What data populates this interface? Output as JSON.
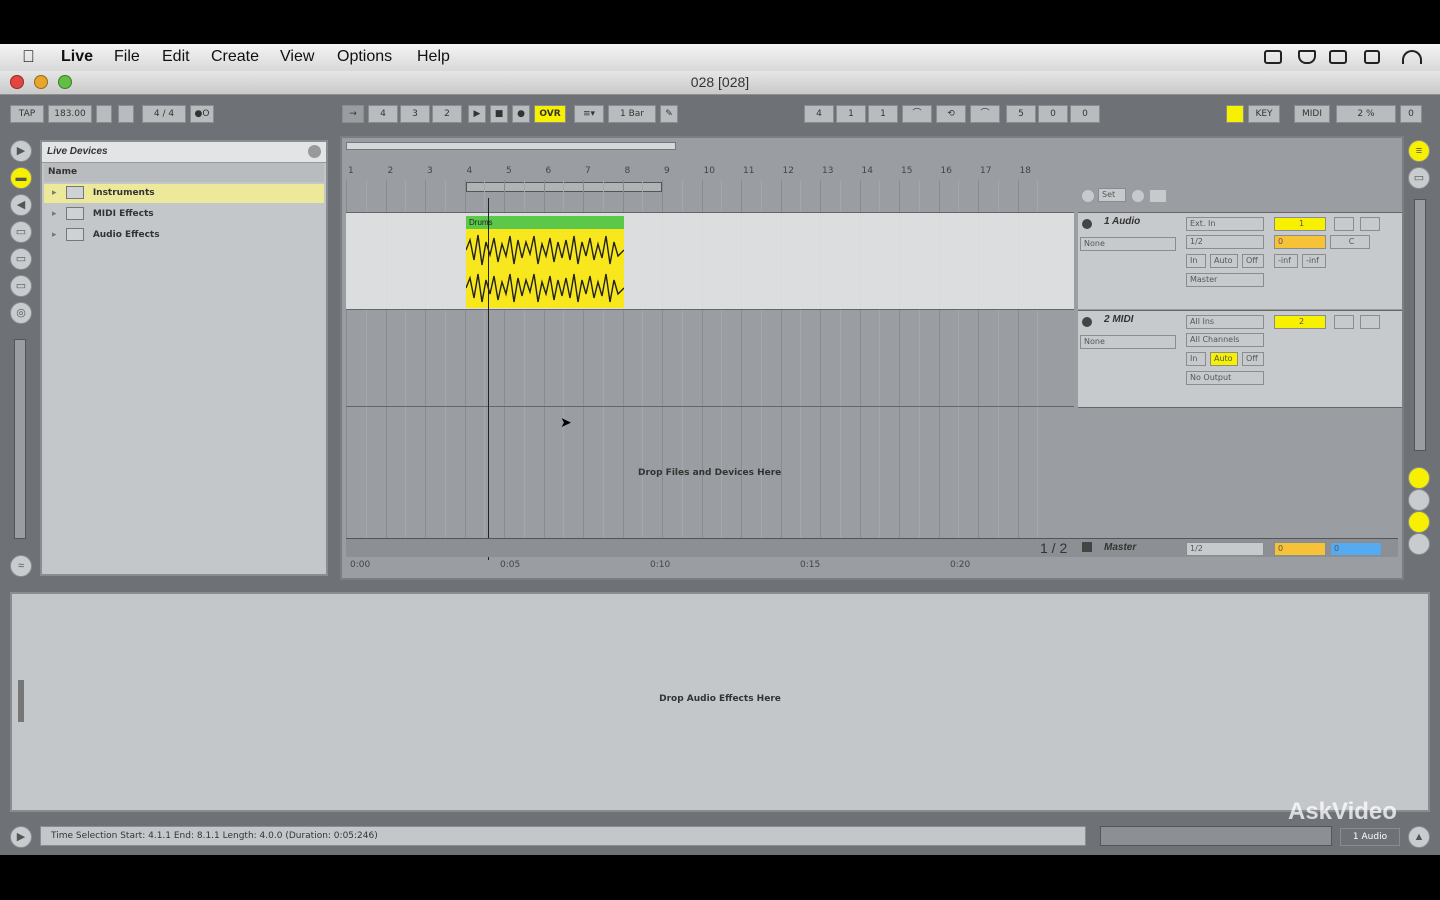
{
  "menubar": {
    "apple": "",
    "items": [
      "Live",
      "File",
      "Edit",
      "Create",
      "View",
      "Options",
      "Help"
    ]
  },
  "window": {
    "title": "028 [028]"
  },
  "transport": {
    "tap": "TAP",
    "tempo": "183.00",
    "signature": "4 / 4",
    "metro": "●O",
    "position": [
      "4",
      "3",
      "2"
    ],
    "ovr": "OVR",
    "quantize": "1 Bar",
    "loop_start": [
      "4",
      "1",
      "1"
    ],
    "loop_length": [
      "5",
      "0",
      "0"
    ],
    "key": "KEY",
    "midi": "MIDI",
    "cpu": "2 %",
    "disk": "0"
  },
  "browser": {
    "title": "Live Devices",
    "column": "Name",
    "items": [
      "Instruments",
      "MIDI Effects",
      "Audio Effects"
    ]
  },
  "arrangement": {
    "bars": [
      "1",
      "2",
      "3",
      "4",
      "5",
      "6",
      "7",
      "8",
      "9",
      "10",
      "11",
      "12",
      "13",
      "14",
      "15",
      "16",
      "17",
      "18"
    ],
    "times": [
      "0:00",
      "0:05",
      "0:10",
      "0:15",
      "0:20"
    ],
    "clip_name": "Drums",
    "drop_text": "Drop Files and Devices Here",
    "page": "1 / 2",
    "set_label": "Set",
    "tracks": [
      {
        "name": "1 Audio",
        "input": "Ext. In",
        "input_ch": "1/2",
        "monitor": [
          "In",
          "Auto",
          "Off"
        ],
        "output": "Master",
        "number": "1",
        "vol": "0",
        "pan": "C",
        "sends": [
          "-inf",
          "-inf"
        ],
        "chain": "None"
      },
      {
        "name": "2 MIDI",
        "input": "All Ins",
        "input_ch": "All Channels",
        "monitor": [
          "In",
          "Auto",
          "Off"
        ],
        "output": "No Output",
        "number": "2",
        "chain": "None"
      }
    ],
    "master": {
      "name": "Master",
      "output": "1/2",
      "vol": "0",
      "pan": "0"
    }
  },
  "device_panel": {
    "drop_text": "Drop Audio Effects Here"
  },
  "status": {
    "text": "Time Selection    Start: 4.1.1    End: 8.1.1    Length: 4.0.0  (Duration: 0:05:246)",
    "track": "1 Audio"
  },
  "watermark": "AskVideo",
  "colors": {
    "clip": "#f7e71c",
    "clip_header": "#5cc84a",
    "accent": "#f7f100",
    "orange": "#f6c237",
    "blue": "#55aaf0"
  }
}
